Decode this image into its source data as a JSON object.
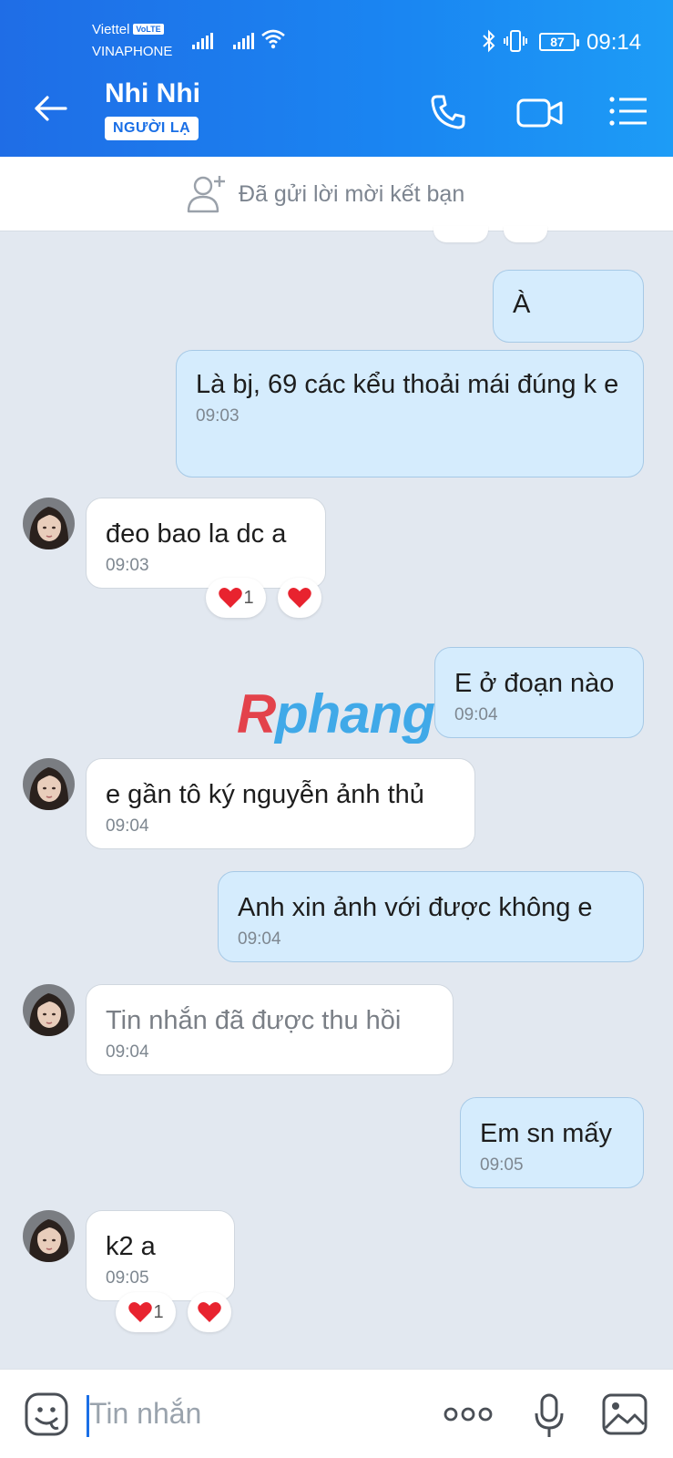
{
  "status_bar": {
    "carrier_primary": "Viettel",
    "volte": "VoLTE",
    "carrier_secondary": "VINAPHONE",
    "battery": "87",
    "time": "09:14"
  },
  "header": {
    "contact_name": "Nhi Nhi",
    "badge": "NGƯỜI LẠ",
    "icons": [
      "back-arrow-icon",
      "phone-icon",
      "video-camera-icon",
      "menu-icon"
    ]
  },
  "friend_request": {
    "text": "Đã gửi lời mời kết bạn",
    "icon": "add-friend-icon"
  },
  "messages": [
    {
      "direction": "out",
      "text": "À",
      "time": ""
    },
    {
      "direction": "out",
      "text": "Là bj, 69 các kểu thoải mái đúng k e",
      "time": "09:03"
    },
    {
      "direction": "in",
      "text": "đeo bao la dc a",
      "time": "09:03",
      "reactions": {
        "count": "1"
      }
    },
    {
      "direction": "out",
      "text": "E ở đoạn nào",
      "time": "09:04"
    },
    {
      "direction": "in",
      "text": "e gần tô ký nguyễn ảnh thủ",
      "time": "09:04"
    },
    {
      "direction": "out",
      "text": "Anh xin ảnh với được không e",
      "time": "09:04"
    },
    {
      "direction": "in",
      "text": "Tin nhắn đã được thu hồi",
      "time": "09:04",
      "recalled": true
    },
    {
      "direction": "out",
      "text": "Em sn mấy",
      "time": "09:05"
    },
    {
      "direction": "in",
      "text": "k2 a",
      "time": "09:05",
      "reactions": {
        "count": "1"
      }
    }
  ],
  "watermark": {
    "text": "Rphang",
    "colors": {
      "r": "#e4313a",
      "rest": "#2fa3e8"
    }
  },
  "composer": {
    "placeholder": "Tin nhắn",
    "icons": [
      "sticker-icon",
      "more-icon",
      "microphone-icon",
      "gallery-icon"
    ]
  },
  "colors": {
    "header_bg": "#1a86f2",
    "outgoing_bubble": "#d5ecfd",
    "incoming_bubble": "#ffffff",
    "chat_bg": "#e2e8f0",
    "heart": "#e8232f"
  }
}
